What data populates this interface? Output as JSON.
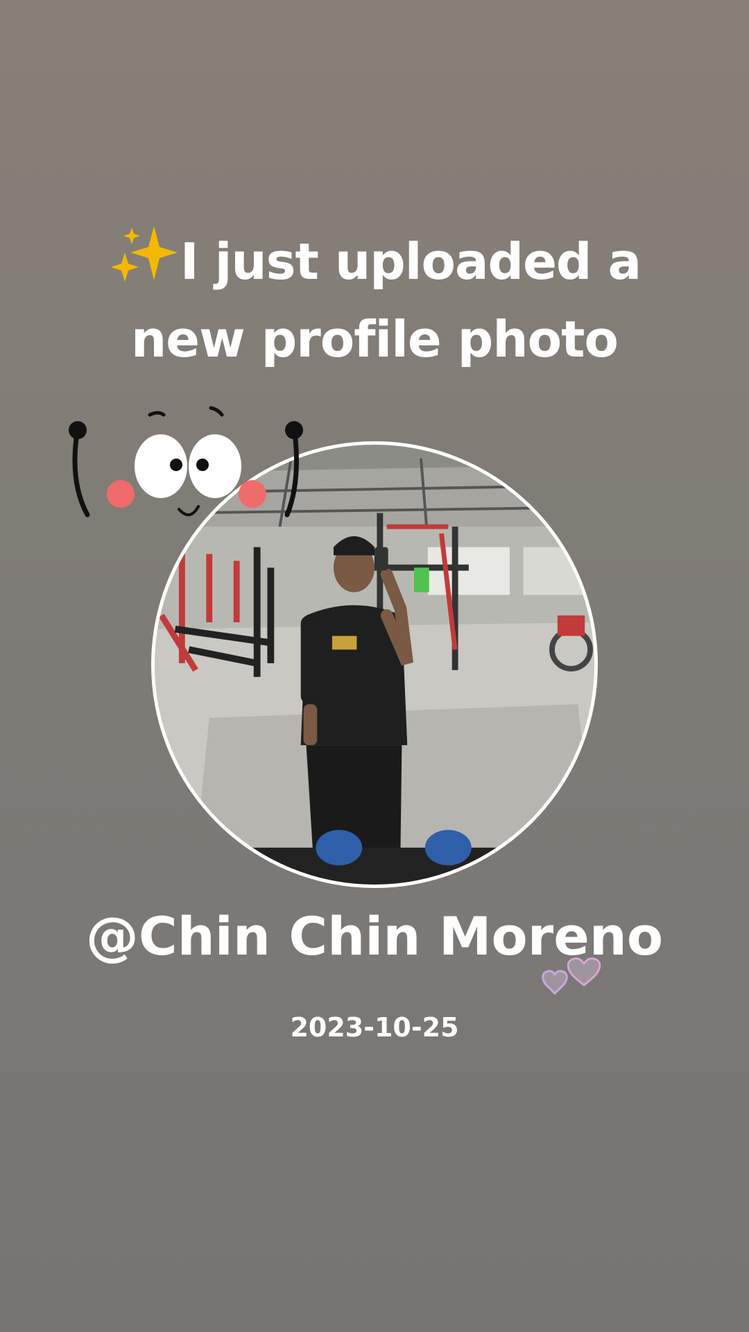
{
  "story": {
    "headline_line1": "I just uploaded a",
    "headline_line2": "new profile photo",
    "username": "@Chin Chin Moreno",
    "date": "2023-10-25"
  },
  "icons": {
    "headline_emoji": "sparkles-icon",
    "sticker": "cute-face-sticker",
    "hearts": "hearts-icon"
  },
  "colors": {
    "background": "#807b76",
    "text": "#ffffff",
    "sparkle": "#f5b800",
    "cheek": "#f06b6b"
  }
}
